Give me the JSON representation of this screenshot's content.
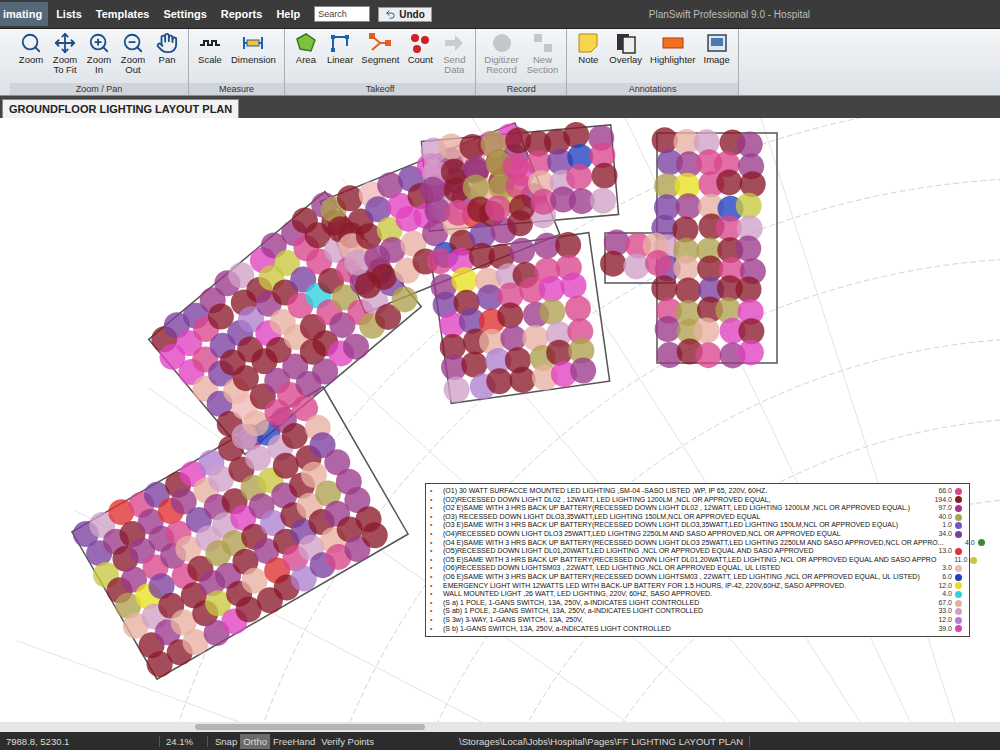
{
  "window": {
    "title": "PlanSwift Professional 9.0 - Hospital"
  },
  "menu": {
    "items": [
      {
        "label": "imating",
        "selected": true
      },
      {
        "label": "Lists",
        "selected": false
      },
      {
        "label": "Templates",
        "selected": false
      },
      {
        "label": "Settings",
        "selected": false
      },
      {
        "label": "Reports",
        "selected": false
      },
      {
        "label": "Help",
        "selected": false
      }
    ],
    "search": {
      "placeholder": "Search"
    },
    "undo": "Undo"
  },
  "ribbon": {
    "groups": [
      {
        "label": "Zoom / Pan",
        "buttons": [
          {
            "lines": [
              "Zoom"
            ],
            "disabled": false
          },
          {
            "lines": [
              "Zoom",
              "To Fit"
            ],
            "disabled": false
          },
          {
            "lines": [
              "Zoom",
              "In"
            ],
            "disabled": false
          },
          {
            "lines": [
              "Zoom",
              "Out"
            ],
            "disabled": false
          },
          {
            "lines": [
              "Pan"
            ],
            "disabled": false
          }
        ]
      },
      {
        "label": "Measure",
        "buttons": [
          {
            "lines": [
              "Scale"
            ],
            "disabled": false
          },
          {
            "lines": [
              "Dimension"
            ],
            "disabled": false
          }
        ]
      },
      {
        "label": "Takeoff",
        "buttons": [
          {
            "lines": [
              "Area"
            ],
            "disabled": false
          },
          {
            "lines": [
              "Linear"
            ],
            "disabled": false
          },
          {
            "lines": [
              "Segment"
            ],
            "disabled": false
          },
          {
            "lines": [
              "Count"
            ],
            "disabled": false
          },
          {
            "lines": [
              "Send",
              "Data"
            ],
            "disabled": true
          }
        ]
      },
      {
        "label": "Record",
        "buttons": [
          {
            "lines": [
              "Digitizer",
              "Record"
            ],
            "disabled": true
          },
          {
            "lines": [
              "New",
              "Section"
            ],
            "disabled": true
          }
        ]
      },
      {
        "label": "Annotations",
        "buttons": [
          {
            "lines": [
              "Note"
            ],
            "disabled": false
          },
          {
            "lines": [
              "Overlay"
            ],
            "disabled": false
          },
          {
            "lines": [
              "Highlighter"
            ],
            "disabled": false
          },
          {
            "lines": [
              "Image"
            ],
            "disabled": false
          }
        ]
      }
    ]
  },
  "page_tab": {
    "label": "GROUNDFLOOR LIGHTING LAYOUT PLAN",
    "selected": true
  },
  "legend": {
    "items": [
      {
        "marker": "•",
        "text": "(O1) 30 WATT SURFACCE MOUNTED LED LIGHTING ,SM-04 -SASO LISTED ,WP, IP 65, 220V, 60HZ.",
        "count": "66.0",
        "color": "#d9468c"
      },
      {
        "marker": "•",
        "text": "(O2)RECESSED DOWN LIGHT DL02 , 12WATT, LED LIGHTING 1200LM ,NCL OR APPROVED EQUAL,",
        "count": "194.0",
        "color": "#8b1a2a"
      },
      {
        "marker": "•",
        "text": "(O2 E)SAME WITH 3 HRS BACK UP BATTERY(RECESSED DOWN LIGHT DL02 , 12WATT, LED LIGHTING 1200LM ,NCL OR APPROVED EQUAL.)",
        "count": "97.0",
        "color": "#9b3a8a"
      },
      {
        "marker": "•",
        "text": "(O3) RECESSED DOWN LIGHT DLO3,35WATT,LED LIGHTING 150LM,NCL OR APPROVED EQUAL",
        "count": "40.0",
        "color": "#b0a050"
      },
      {
        "marker": "•",
        "text": "(O3 E)SAME WITH 3 HRS BACK UP BATTERY(RECESSED DOWN LIGHT DLO3,35WATT,LED LIGHTING 150LM,NCL OR APPROVED EQUAL)",
        "count": "1.0",
        "color": "#6a5acd"
      },
      {
        "marker": "•",
        "text": "(O4)RECESSED DOWN LIGHT DLO3 25WATT,LED LIGHTING 2250LM AND SASO APPROVED,NCL OR APPROVED EQUAL",
        "count": "34.0",
        "color": "#7b3fa0"
      },
      {
        "marker": "•",
        "text": "(O4 E)SAME WITH 3 HRS BACK UP BATTERY(RECESSED DOWN LIGHT DLO3 25WATT,LED LIGHTING 2250LM AND SASO APPROVED,NCL OR APPRO...",
        "count": "4.0",
        "color": "#3a8a3a"
      },
      {
        "marker": "•",
        "text": "(O5)RECESSED DOWN LIGHT DL01,20WATT,LED LIGHTING ,NCL OR APPROVED EQUAL AND SASO APPROVED",
        "count": "13.0",
        "color": "#e03030"
      },
      {
        "marker": "•",
        "text": "(O5 E)SAME WITH 3 HRS BACK UP BATTERY(RECESSED DOWN LIGHT DL01,20WATT,LED LIGHTING ,NCL OR APPROVED EQUAL AND SASO APPRO",
        "count": "11.0",
        "color": "#c8c840"
      },
      {
        "marker": "•",
        "text": "(O6)RECESSED DOWN LIGHTSM03 , 22WATT, LED LIGHTING ,NCL OR APPROVED EQUAL, UL LISTED",
        "count": "3.0",
        "color": "#f0b8b8"
      },
      {
        "marker": "•",
        "text": "(O6 E)SAME WITH 3 HRS BACK UP BATTERY(RECESSED DOWN LIGHTSM03 , 22WATT, LED LIGHTING ,NCL OR APPROVED EQUAL, UL LISTED)",
        "count": "6.0",
        "color": "#2040c0"
      },
      {
        "marker": "•",
        "text": "EMERGENCY LIGHT WITH 12WATTS LED WITH BACK-UP BATTERY FOR 1.5 HOURS, IP-42, 220V,60HZ, SASO APPROVED.",
        "count": "12.0",
        "color": "#e8e020"
      },
      {
        "marker": "•",
        "text": "WALL MOUNTED LIGHT ,26 WATT, LED LIGHTING, 220V, 60HZ, SASO APPROVED.",
        "count": "4.0",
        "color": "#30d0e0"
      },
      {
        "marker": "•",
        "text": "(S a) 1 POLE, 1-GANS SWITCH, 13A, 250V, a-INDICATES LIGHT CONTROLLED",
        "count": "67.0",
        "color": "#e8b0a0"
      },
      {
        "marker": "•",
        "text": "(S ab) 1 POLE, 2-GANS SWITCH, 13A, 250V, a-INDICATES LIGHT CONTROLLED",
        "count": "33.0",
        "color": "#d0a0c8"
      },
      {
        "marker": "•",
        "text": "(S 3w) 3-WAY, 1-GANS SWITCH, 13A, 250V,",
        "count": "12.0",
        "color": "#b080d0"
      },
      {
        "marker": "•",
        "text": "(S b) 1-GANS SWITCH, 13A, 250V, a-INDICATES LIGHT CONTROLLED",
        "count": "39.0",
        "color": "#e040c0"
      }
    ]
  },
  "status_bar": {
    "coordinates": "7988.8, 5230.1",
    "zoom": "24.1%",
    "toggles": [
      {
        "label": "Snap",
        "selected": false
      },
      {
        "label": "Ortho",
        "selected": true
      },
      {
        "label": "FreeHand",
        "selected": false
      },
      {
        "label": "Verify Points",
        "selected": false
      }
    ],
    "path": "\\Storages\\Local\\Jobs\\Hospital\\Pages\\FF LIGHTING LAYOUT PLAN"
  }
}
